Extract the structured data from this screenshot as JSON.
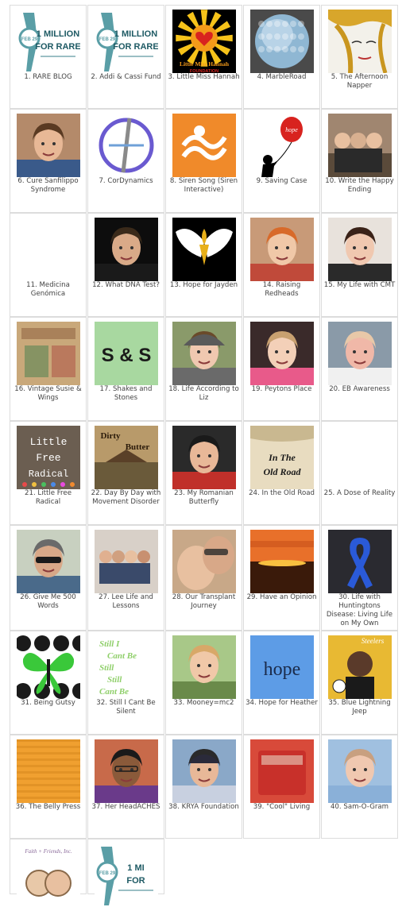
{
  "items": [
    {
      "num": "1.",
      "label": "RARE BLOG",
      "icon": "rare-ribbon-icon",
      "thumb_text": [
        "1 MILLION",
        "FOR RARE",
        "FEB 29"
      ]
    },
    {
      "num": "2.",
      "label": "Addi & Cassi Fund",
      "icon": "rare-ribbon-icon",
      "thumb_text": [
        "1 MILLION",
        "FOR RARE",
        "FEB 29"
      ]
    },
    {
      "num": "3.",
      "label": "Little Miss Hannah",
      "icon": "sun-heart-icon",
      "thumb_text": [
        "Little Miss Hannah",
        "FOUNDATION"
      ]
    },
    {
      "num": "4.",
      "label": "MarbleRoad",
      "icon": "marble-sphere-icon"
    },
    {
      "num": "5.",
      "label": "The Afternoon Napper",
      "icon": "sketch-face-icon"
    },
    {
      "num": "6.",
      "label": "Cure Sanfilippo Syndrome",
      "icon": "photo-child-icon"
    },
    {
      "num": "7.",
      "label": "CorDynamics",
      "icon": "cordynamics-logo-icon"
    },
    {
      "num": "8.",
      "label": "Siren Song (Siren Interactive)",
      "icon": "siren-logo-icon"
    },
    {
      "num": "9.",
      "label": "Saving Case",
      "icon": "hope-balloon-icon",
      "thumb_text": [
        "hope"
      ]
    },
    {
      "num": "10.",
      "label": "Write the Happy Ending",
      "icon": "photo-family-icon"
    },
    {
      "num": "11.",
      "label": "Medicina Genómica",
      "icon": "blank-icon"
    },
    {
      "num": "12.",
      "label": "What DNA Test?",
      "icon": "photo-man-icon"
    },
    {
      "num": "13.",
      "label": "Hope for Jayden",
      "icon": "wings-fleur-icon"
    },
    {
      "num": "14.",
      "label": "Raising Redheads",
      "icon": "photo-redhead-icon"
    },
    {
      "num": "15.",
      "label": "My Life with CMT",
      "icon": "photo-woman-icon"
    },
    {
      "num": "16.",
      "label": "Vintage Susie & Wings",
      "icon": "vintage-collage-icon"
    },
    {
      "num": "17.",
      "label": "Shakes and Stones",
      "icon": "ss-logo-icon",
      "thumb_text": [
        "S & S"
      ]
    },
    {
      "num": "18.",
      "label": "Life According to Liz",
      "icon": "photo-girl-cap-icon"
    },
    {
      "num": "19.",
      "label": "Peytons Place",
      "icon": "photo-little-girl-icon"
    },
    {
      "num": "20.",
      "label": "EB Awareness",
      "icon": "photo-baby-icon"
    },
    {
      "num": "21.",
      "label": "Little Free Radical",
      "icon": "chalkboard-icon",
      "thumb_text": [
        "Little",
        "Free",
        "Radical"
      ]
    },
    {
      "num": "22.",
      "label": "Day By Day with Movement Disorder",
      "icon": "dirty-butter-icon",
      "thumb_text": [
        "Dirty",
        "Butter"
      ]
    },
    {
      "num": "23.",
      "label": "My Romanian Butterfly",
      "icon": "photo-boy-icon"
    },
    {
      "num": "24.",
      "label": "In the Old Road",
      "icon": "old-road-icon",
      "thumb_text": [
        "In The",
        "Old Road"
      ]
    },
    {
      "num": "25.",
      "label": "A Dose of Reality",
      "icon": "blank-icon"
    },
    {
      "num": "26.",
      "label": "Give Me 500 Words",
      "icon": "photo-man-sunglasses-icon"
    },
    {
      "num": "27.",
      "label": "Lee Life and Lessons",
      "icon": "photo-group-icon"
    },
    {
      "num": "28.",
      "label": "Our Transplant Journey",
      "icon": "photo-closeup-icon"
    },
    {
      "num": "29.",
      "label": "Have an Opinion",
      "icon": "sunset-icon"
    },
    {
      "num": "30.",
      "label": "Life with Huntingtons Disease: Living Life on My Own",
      "icon": "blue-ribbon-icon"
    },
    {
      "num": "31.",
      "label": "Being Gutsy",
      "icon": "green-butterfly-icon"
    },
    {
      "num": "32.",
      "label": "Still I Cant Be Silent",
      "icon": "still-text-icon",
      "thumb_text": [
        "Still I",
        "Cant Be",
        "Still",
        "Still",
        "Cant Be"
      ]
    },
    {
      "num": "33.",
      "label": "Mooney=mc2",
      "icon": "photo-toddler-icon"
    },
    {
      "num": "34.",
      "label": "Hope for Heather",
      "icon": "hope-text-icon",
      "thumb_text": [
        "hope"
      ]
    },
    {
      "num": "35.",
      "label": "Blue Lightning Jeep",
      "icon": "steelers-photo-icon",
      "thumb_text": [
        "Steelers"
      ]
    },
    {
      "num": "36.",
      "label": "The Belly Press",
      "icon": "wood-texture-icon"
    },
    {
      "num": "37.",
      "label": "Her HeadACHES",
      "icon": "photo-woman-glasses-icon"
    },
    {
      "num": "38.",
      "label": "KRYA Foundation",
      "icon": "photo-kid-helmet-icon"
    },
    {
      "num": "39.",
      "label": "\"Cool\" Living",
      "icon": "red-cooler-icon"
    },
    {
      "num": "40.",
      "label": "Sam-O-Gram",
      "icon": "photo-sleeping-baby-icon"
    },
    {
      "num": "",
      "label": "",
      "icon": "faith-friends-icon",
      "thumb_text": [
        "Faith + Friends, Inc."
      ]
    },
    {
      "num": "",
      "label": "",
      "icon": "rare-ribbon-icon",
      "thumb_text": [
        "1 MI",
        "FOR",
        "FEB 29"
      ]
    }
  ]
}
